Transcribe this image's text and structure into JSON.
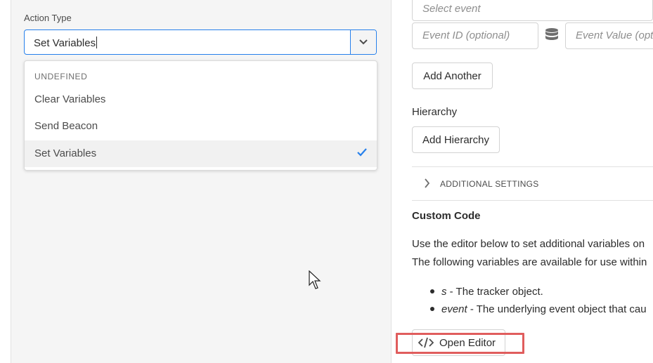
{
  "action_type": {
    "label": "Action Type",
    "value": "Set Variables",
    "dropdown": {
      "header": "UNDEFINED",
      "options": [
        "Clear Variables",
        "Send Beacon",
        "Set Variables"
      ],
      "selected": "Set Variables"
    }
  },
  "events": {
    "select_placeholder": "Select event",
    "id_placeholder": "Event ID (optional)",
    "value_placeholder": "Event Value (optional)",
    "add_another": "Add Another"
  },
  "hierarchy": {
    "label": "Hierarchy",
    "add_button": "Add Hierarchy"
  },
  "additional_settings": "ADDITIONAL SETTINGS",
  "custom_code": {
    "title": "Custom Code",
    "desc_line1": "Use the editor below to set additional variables on",
    "desc_line2": "The following variables are available for use within",
    "bullets": [
      {
        "term": "s",
        "text": " - The tracker object."
      },
      {
        "term": "event",
        "text": " - The underlying event object that cau"
      }
    ],
    "open_editor": "Open Editor"
  },
  "colors": {
    "accent": "#2680eb",
    "highlight": "#e05d5d"
  }
}
